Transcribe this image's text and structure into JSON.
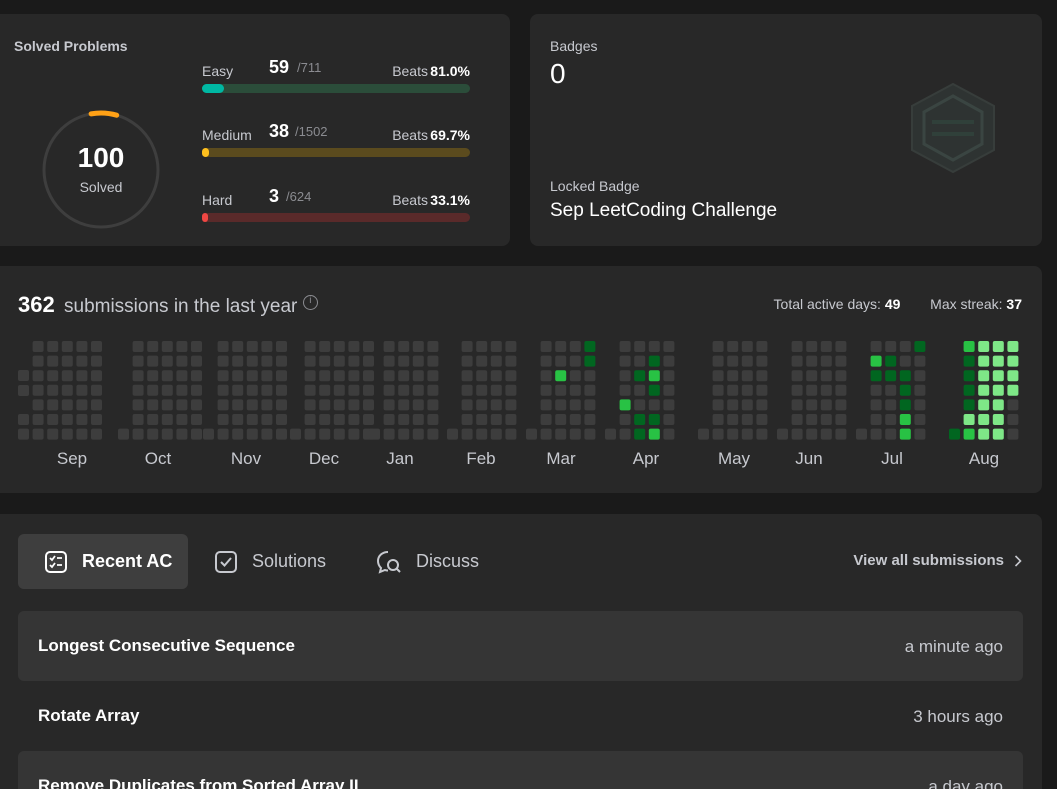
{
  "solved": {
    "label": "Solved Problems",
    "total": "100",
    "total_label": "Solved",
    "ring_color": "#ffa116",
    "difficulties": [
      {
        "name": "Easy",
        "solved": "59",
        "total": "/711",
        "beats_label": "Beats",
        "beats": "81.0%",
        "fraction": 0.083,
        "color": "#00b8a3",
        "track": "#2b4d3a"
      },
      {
        "name": "Medium",
        "solved": "38",
        "total": "/1502",
        "beats_label": "Beats",
        "beats": "69.7%",
        "fraction": 0.025,
        "color": "#ffc01e",
        "track": "#5b4b1e"
      },
      {
        "name": "Hard",
        "solved": "3",
        "total": "/624",
        "beats_label": "Beats",
        "beats": "33.1%",
        "fraction": 0.005,
        "color": "#ef4743",
        "track": "#5a2a2a"
      }
    ]
  },
  "badges": {
    "label": "Badges",
    "count": "0",
    "locked_label": "Locked Badge",
    "locked_name": "Sep LeetCoding Challenge"
  },
  "submissions": {
    "count": "362",
    "text": "submissions in the last year",
    "active_label": "Total active days:",
    "active_days": "49",
    "streak_label": "Max streak:",
    "max_streak": "37",
    "months": [
      "Sep",
      "Oct",
      "Nov",
      "Dec",
      "Jan",
      "Feb",
      "Mar",
      "Apr",
      "May",
      "Jun",
      "Jul",
      "Aug"
    ],
    "colors": {
      "empty": "#3d3d3d",
      "low": "#016620",
      "mid": "#28c244",
      "high": "#7ee787"
    }
  },
  "recent": {
    "tabs": [
      {
        "label": "Recent AC",
        "icon": "checklist-icon"
      },
      {
        "label": "Solutions",
        "icon": "check-square-icon"
      },
      {
        "label": "Discuss",
        "icon": "discuss-icon"
      }
    ],
    "view_all": "View all submissions",
    "items": [
      {
        "title": "Longest Consecutive Sequence",
        "time": "a minute ago"
      },
      {
        "title": "Rotate Array",
        "time": "3 hours ago"
      },
      {
        "title": "Remove Duplicates from Sorted Array II",
        "time": "a day ago"
      }
    ]
  }
}
